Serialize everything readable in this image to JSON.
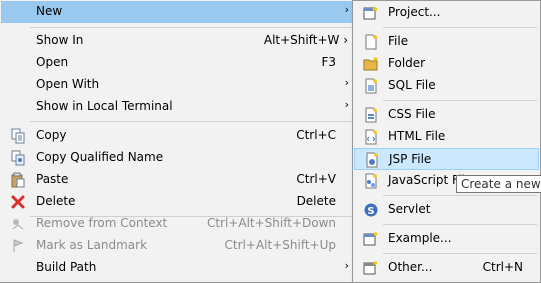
{
  "main_menu": {
    "items": [
      {
        "label": "New",
        "accel": "",
        "arrow": "›",
        "icon": "none"
      },
      {
        "label": "Show In",
        "accel": "Alt+Shift+W ›",
        "arrow": "",
        "icon": "none"
      },
      {
        "label": "Open",
        "accel": "F3",
        "arrow": "",
        "icon": "none"
      },
      {
        "label": "Open With",
        "accel": "",
        "arrow": "›",
        "icon": "none"
      },
      {
        "label": "Show in Local Terminal",
        "accel": "",
        "arrow": "›",
        "icon": "none"
      },
      {
        "label": "Copy",
        "accel": "Ctrl+C",
        "arrow": "",
        "icon": "copy-icon"
      },
      {
        "label": "Copy Qualified Name",
        "accel": "",
        "arrow": "",
        "icon": "copy-qualified-icon"
      },
      {
        "label": "Paste",
        "accel": "Ctrl+V",
        "arrow": "",
        "icon": "paste-icon"
      },
      {
        "label": "Delete",
        "accel": "Delete",
        "arrow": "",
        "icon": "delete-icon"
      },
      {
        "label": "Remove from Context",
        "accel": "Ctrl+Alt+Shift+Down",
        "arrow": "",
        "icon": "remove-context-icon"
      },
      {
        "label": "Mark as Landmark",
        "accel": "Ctrl+Alt+Shift+Up",
        "arrow": "",
        "icon": "landmark-icon"
      },
      {
        "label": "Build Path",
        "accel": "",
        "arrow": "›",
        "icon": "none"
      }
    ]
  },
  "sub_menu": {
    "items": [
      {
        "label": "Project...",
        "accel": "",
        "icon": "project-icon"
      },
      {
        "label": "File",
        "accel": "",
        "icon": "file-icon"
      },
      {
        "label": "Folder",
        "accel": "",
        "icon": "folder-icon"
      },
      {
        "label": "SQL File",
        "accel": "",
        "icon": "sql-file-icon"
      },
      {
        "label": "CSS File",
        "accel": "",
        "icon": "css-file-icon"
      },
      {
        "label": "HTML File",
        "accel": "",
        "icon": "html-file-icon"
      },
      {
        "label": "JSP File",
        "accel": "",
        "icon": "jsp-file-icon"
      },
      {
        "label": "JavaScript File",
        "accel": "",
        "icon": "javascript-file-icon"
      },
      {
        "label": "Servlet",
        "accel": "",
        "icon": "servlet-icon"
      },
      {
        "label": "Example...",
        "accel": "",
        "icon": "example-icon"
      },
      {
        "label": "Other...",
        "accel": "Ctrl+N",
        "icon": "other-icon"
      }
    ]
  },
  "tooltip": {
    "text": "Create a new JSP file"
  },
  "colors": {
    "highlight": "#99c9ef",
    "sub_highlight": "#cce8ff",
    "disabled": "#8c8c8c"
  }
}
